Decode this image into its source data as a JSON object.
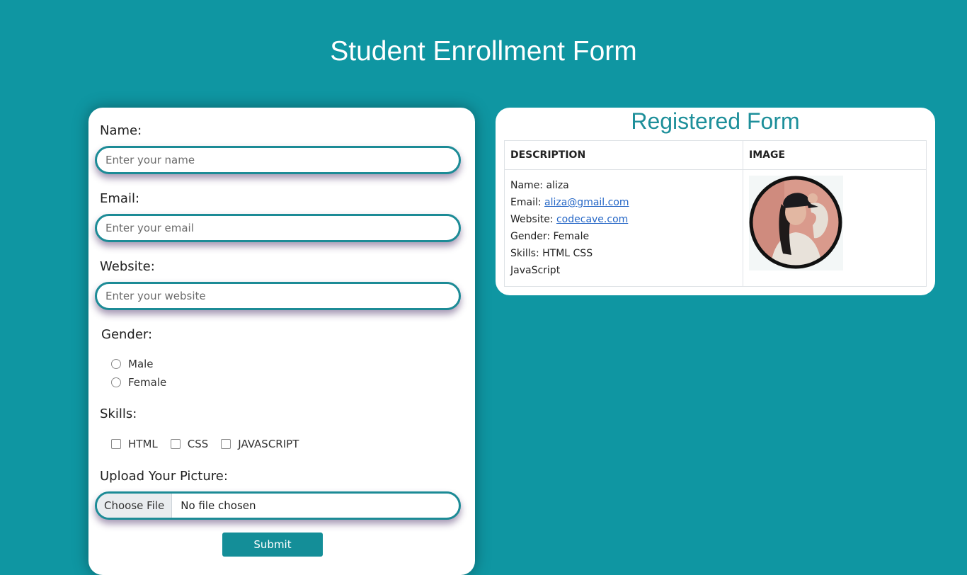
{
  "page": {
    "title": "Student Enrollment Form"
  },
  "form": {
    "name_label": "Name:",
    "name_placeholder": "Enter your name",
    "email_label": "Email:",
    "email_placeholder": "Enter your email",
    "website_label": "Website:",
    "website_placeholder": "Enter your website",
    "gender_label": "Gender:",
    "gender_options": [
      "Male",
      "Female"
    ],
    "skills_label": "Skills:",
    "skills_options": [
      "HTML",
      "CSS",
      "JAVASCRIPT"
    ],
    "upload_label": "Upload Your Picture:",
    "file_button": "Choose File",
    "file_status": "No file chosen",
    "submit_label": "Submit"
  },
  "registered": {
    "title": "Registered Form",
    "headers": [
      "DESCRIPTION",
      "IMAGE"
    ],
    "name": "Name: aliza",
    "email_prefix": "Email: ",
    "email_value": "aliza@gmail.com",
    "website_prefix": "Website: ",
    "website_value": "codecave.com",
    "gender": "Gender: Female",
    "skills_line1": "Skills: HTML CSS",
    "skills_line2": "JavaScript"
  },
  "colors": {
    "background": "#0f96a2",
    "accent": "#1d8f9a",
    "link": "#2466c6"
  }
}
